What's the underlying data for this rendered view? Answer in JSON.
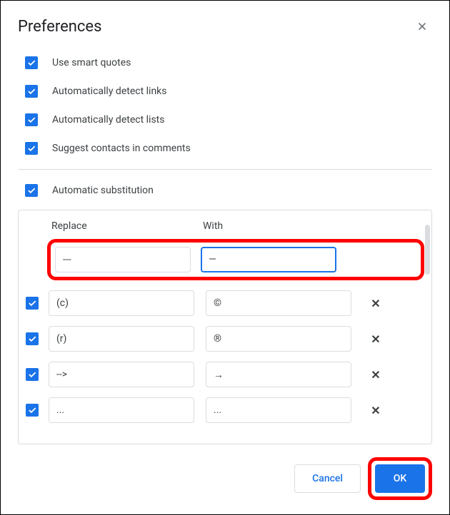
{
  "title": "Preferences",
  "options": [
    {
      "label": "Use smart quotes",
      "checked": true
    },
    {
      "label": "Automatically detect links",
      "checked": true
    },
    {
      "label": "Automatically detect lists",
      "checked": true
    },
    {
      "label": "Suggest contacts in comments",
      "checked": true
    }
  ],
  "auto_sub": {
    "label": "Automatic substitution",
    "checked": true
  },
  "table": {
    "headers": {
      "replace": "Replace",
      "with": "With"
    },
    "new_row": {
      "replace": "---",
      "with": "—"
    },
    "rows": [
      {
        "checked": true,
        "replace": "(c)",
        "with": "©"
      },
      {
        "checked": true,
        "replace": "(r)",
        "with": "®"
      },
      {
        "checked": true,
        "replace": "-->",
        "with": "→"
      },
      {
        "checked": true,
        "replace": "...",
        "with": "..."
      }
    ]
  },
  "buttons": {
    "cancel": "Cancel",
    "ok": "OK"
  }
}
